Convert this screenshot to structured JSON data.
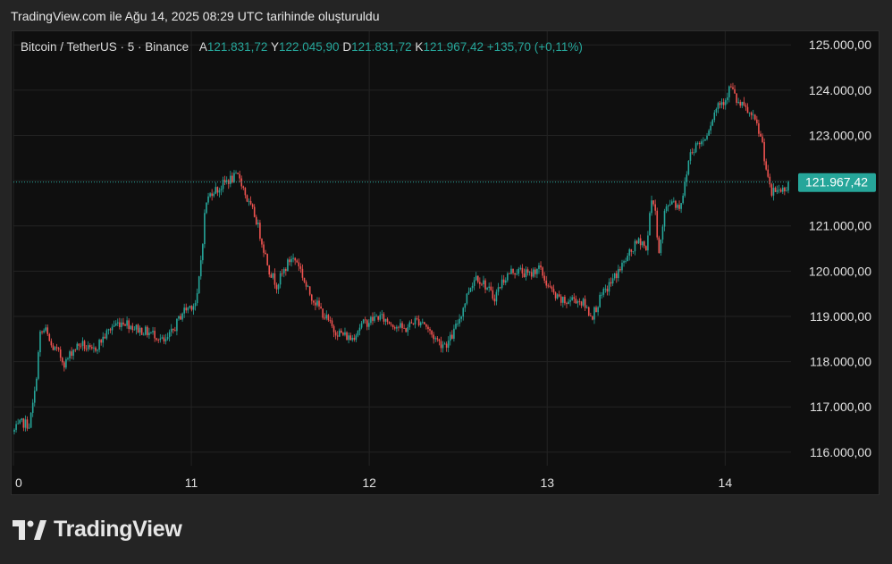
{
  "caption": "TradingView.com ile Ağu 14, 2025 08:29 UTC tarihinde oluşturuldu",
  "legend": {
    "symbol": "Bitcoin / TetherUS · 5 · Binance",
    "open_key": "A",
    "open": "121.831,72",
    "high_key": "Y",
    "high": "122.045,90",
    "low_key": "D",
    "low": "121.831,72",
    "close_key": "K",
    "close": "121.967,42",
    "change": "+135,70 (+0,11%)"
  },
  "brand": "TradingView",
  "colors": {
    "up": "#26a69a",
    "down": "#ef5350",
    "grid": "#232323",
    "axis_text": "#e0e0e0",
    "price_tag": "#26a69a"
  },
  "chart_data": {
    "type": "candlestick",
    "title": "",
    "series_name": "Bitcoin / TetherUS · 5 · Binance",
    "y_ticks": [
      125000,
      124000,
      123000,
      122000,
      121000,
      120000,
      119000,
      118000,
      117000,
      116000
    ],
    "y_tick_labels": [
      "125.000,00",
      "124.000,00",
      "123.000,00",
      "",
      "121.000,00",
      "120.000,00",
      "119.000,00",
      "118.000,00",
      "117.000,00",
      "116.000,00"
    ],
    "ylim": [
      115700,
      125300
    ],
    "x_ticks": [
      10,
      11,
      12,
      13,
      14
    ],
    "x_tick_labels": [
      "0",
      "11",
      "12",
      "13",
      "14"
    ],
    "xlim": [
      10,
      14.37
    ],
    "last_price": 121967.42,
    "last_price_label": "121.967,42",
    "anchors": [
      [
        10.0,
        116450
      ],
      [
        10.05,
        116650
      ],
      [
        10.09,
        116600
      ],
      [
        10.12,
        117300
      ],
      [
        10.15,
        118600
      ],
      [
        10.18,
        118700
      ],
      [
        10.21,
        118350
      ],
      [
        10.25,
        118200
      ],
      [
        10.29,
        117950
      ],
      [
        10.33,
        118250
      ],
      [
        10.38,
        118400
      ],
      [
        10.44,
        118200
      ],
      [
        10.5,
        118500
      ],
      [
        10.56,
        118800
      ],
      [
        10.62,
        118900
      ],
      [
        10.68,
        118750
      ],
      [
        10.75,
        118650
      ],
      [
        10.8,
        118600
      ],
      [
        10.85,
        118400
      ],
      [
        10.9,
        118700
      ],
      [
        10.95,
        119100
      ],
      [
        11.0,
        119250
      ],
      [
        11.03,
        119300
      ],
      [
        11.06,
        120500
      ],
      [
        11.08,
        121500
      ],
      [
        11.12,
        121800
      ],
      [
        11.15,
        121800
      ],
      [
        11.2,
        122000
      ],
      [
        11.27,
        122100
      ],
      [
        11.32,
        121500
      ],
      [
        11.36,
        121200
      ],
      [
        11.4,
        120600
      ],
      [
        11.44,
        120000
      ],
      [
        11.48,
        119700
      ],
      [
        11.52,
        120000
      ],
      [
        11.56,
        120300
      ],
      [
        11.6,
        120200
      ],
      [
        11.65,
        119600
      ],
      [
        11.7,
        119300
      ],
      [
        11.75,
        119000
      ],
      [
        11.8,
        118700
      ],
      [
        11.85,
        118600
      ],
      [
        11.9,
        118500
      ],
      [
        11.95,
        118800
      ],
      [
        12.0,
        118900
      ],
      [
        12.05,
        119000
      ],
      [
        12.1,
        118900
      ],
      [
        12.15,
        118800
      ],
      [
        12.2,
        118700
      ],
      [
        12.25,
        118900
      ],
      [
        12.3,
        118900
      ],
      [
        12.35,
        118600
      ],
      [
        12.4,
        118400
      ],
      [
        12.44,
        118400
      ],
      [
        12.47,
        118600
      ],
      [
        12.52,
        119100
      ],
      [
        12.56,
        119600
      ],
      [
        12.6,
        119900
      ],
      [
        12.65,
        119700
      ],
      [
        12.7,
        119400
      ],
      [
        12.75,
        119800
      ],
      [
        12.8,
        120000
      ],
      [
        12.85,
        120000
      ],
      [
        12.9,
        119900
      ],
      [
        12.95,
        120100
      ],
      [
        13.0,
        119700
      ],
      [
        13.05,
        119400
      ],
      [
        13.1,
        119300
      ],
      [
        13.15,
        119400
      ],
      [
        13.2,
        119300
      ],
      [
        13.25,
        119000
      ],
      [
        13.3,
        119400
      ],
      [
        13.35,
        119700
      ],
      [
        13.4,
        120000
      ],
      [
        13.45,
        120300
      ],
      [
        13.5,
        120600
      ],
      [
        13.53,
        120700
      ],
      [
        13.56,
        120400
      ],
      [
        13.58,
        121600
      ],
      [
        13.6,
        121500
      ],
      [
        13.63,
        120400
      ],
      [
        13.66,
        121300
      ],
      [
        13.7,
        121600
      ],
      [
        13.74,
        121400
      ],
      [
        13.77,
        121800
      ],
      [
        13.8,
        122600
      ],
      [
        13.84,
        122800
      ],
      [
        13.88,
        122900
      ],
      [
        13.92,
        123300
      ],
      [
        13.96,
        123700
      ],
      [
        14.0,
        123800
      ],
      [
        14.03,
        124100
      ],
      [
        14.07,
        123700
      ],
      [
        14.11,
        123600
      ],
      [
        14.15,
        123400
      ],
      [
        14.18,
        123200
      ],
      [
        14.21,
        122800
      ],
      [
        14.24,
        122000
      ],
      [
        14.26,
        121700
      ],
      [
        14.29,
        121800
      ],
      [
        14.33,
        121800
      ],
      [
        14.36,
        121967
      ]
    ]
  }
}
